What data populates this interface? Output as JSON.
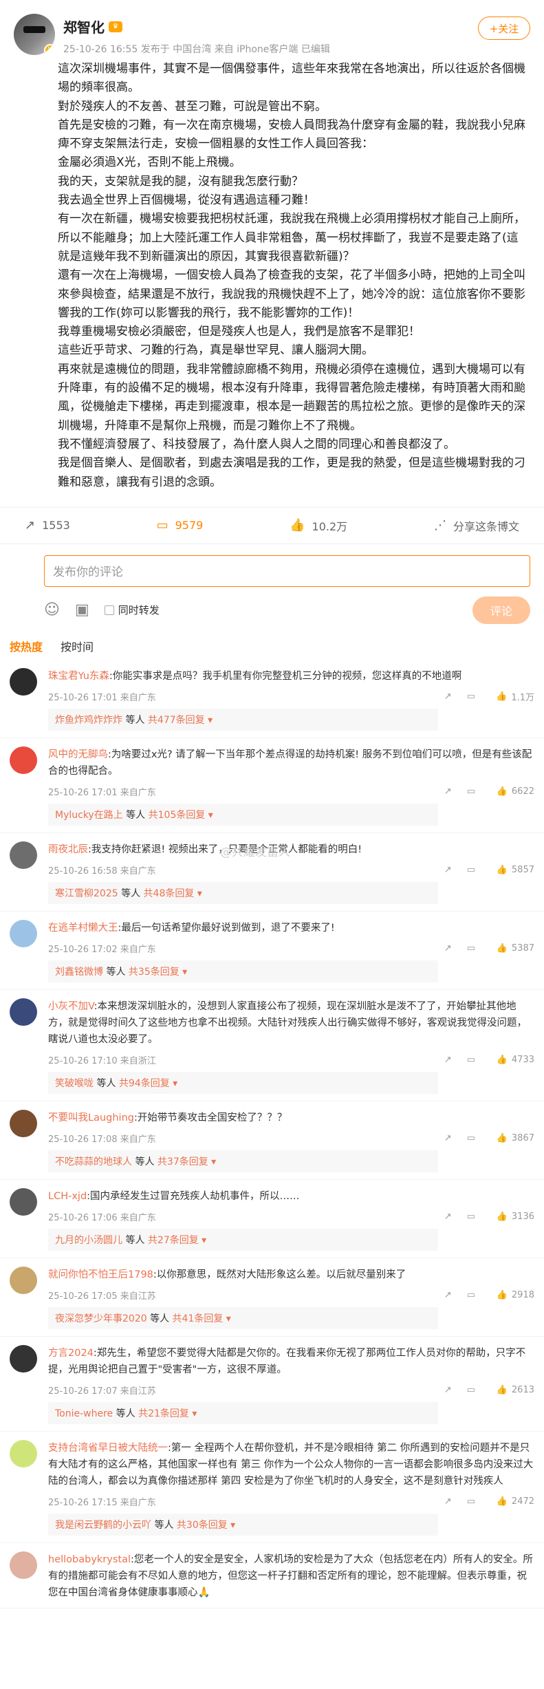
{
  "post": {
    "user_name": "郑智化",
    "meta": "25-10-26 16:55  发布于 中国台湾  来自 iPhone客户端  已编辑",
    "follow_label": "+关注",
    "paragraphs": [
      "這次深圳機場事件，其實不是一個偶發事件，這些年來我常在各地演出，所以往返於各個機場的頻率很高。",
      "對於殘疾人的不友善、甚至刁難，可說是管出不窮。",
      "首先是安檢的刁難，有一次在南京機場，安檢人員問我為什麼穿有金屬的鞋，我說我小兒麻痺不穿支架無法行走，安檢一個粗暴的女性工作人員回答我：",
      "金屬必須過X光，否則不能上飛機。",
      "我的天，支架就是我的腿，沒有腿我怎麼行動？",
      "我去過全世界上百個機場，從沒有遇過這種刁難！",
      "有一次在新疆，機場安檢要我把枴杖託運，我說我在飛機上必須用撐枴杖才能自己上廁所，所以不能離身；加上大陸託運工作人員非常粗魯，萬一枴杖摔斷了，我豈不是要走路了(這就是這幾年我不到新疆演出的原因，其實我很喜歡新疆)？",
      "還有一次在上海機場，一個安檢人員為了檢查我的支架，花了半個多小時，把她的上司全叫來參與檢查，結果還是不放行，我說我的飛機快趕不上了，她冷冷的說：這位旅客你不要影響我的工作(妳可以影響我的飛行，我不能影響妳的工作)！",
      "我尊重機場安檢必須嚴密，但是殘疾人也是人，我們是旅客不是罪犯！",
      "這些近乎苛求、刁難的行為，真是舉世罕見、讓人腦洞大開。",
      "再來就是遠機位的問題，我非常體諒廊橋不夠用，飛機必須停在遠機位，遇到大機場可以有升降車，有的設備不足的機場，根本沒有升降車，我得冒著危險走樓梯，有時頂著大雨和颱風，從機艙走下樓梯，再走到擺渡車，根本是一趟艱苦的馬拉松之旅。更慘的是像昨天的深圳機場，升降車不是幫你上飛機，而是刁難你上不了飛機。",
      "我不懂經濟發展了、科技發展了，為什麼人與人之間的同理心和善良都沒了。",
      "我是個音樂人、是個歌者，到處去演唱是我的工作，更是我的熱愛，但是這些機場對我的刁難和惡意，讓我有引退的念頭。"
    ],
    "actions": {
      "repost": "1553",
      "comments": "9579",
      "likes": "10.2万",
      "share": "分享这条博文"
    }
  },
  "composer": {
    "placeholder": "发布你的评论",
    "repost_label": "同时转发",
    "submit_label": "评论"
  },
  "sort_tabs": {
    "hot": "按热度",
    "time": "按时间"
  },
  "watermark": "@共耀发富人",
  "comments": [
    {
      "user": "珠宝君Yu东森",
      "text": ":你能实事求是点吗？我手机里有你完整登机三分钟的视频，您这样真的不地道啊",
      "meta": "25-10-26 17:01  来自广东",
      "likes": "1.1万",
      "reply_user": "炸鱼炸鸡炸炸炸",
      "reply_suffix": " 等人 ",
      "reply_count": "共477条回复 ▾"
    },
    {
      "user": "风中的无脚鸟",
      "text": ":为啥要过x光? 请了解一下当年那个差点得逞的劫持机案! 服务不到位咱们可以喷，但是有些该配合的也得配合。",
      "meta": "25-10-26 17:01  来自广东",
      "likes": "6622",
      "reply_user": "Mylucky在路上",
      "reply_suffix": " 等人 ",
      "reply_count": "共105条回复 ▾"
    },
    {
      "user": "雨夜北辰",
      "text": ":我支持你赶紧退! 视频出来了，只要是个正常人都能看的明白!",
      "meta": "25-10-26 16:58  来自广东",
      "likes": "5857",
      "reply_user": "寒江雪柳2025",
      "reply_suffix": " 等人 ",
      "reply_count": "共48条回复 ▾"
    },
    {
      "user": "在逃羊村懒大王",
      "text": ":最后一句话希望你最好说到做到，退了不要来了!",
      "meta": "25-10-26 17:02  来自广东",
      "likes": "5387",
      "reply_user": "刘鑫铭微博",
      "reply_suffix": " 等人 ",
      "reply_count": "共35条回复 ▾"
    },
    {
      "user": "小灰不加V",
      "text": ":本来想泼深圳脏水的，没想到人家直接公布了视频，现在深圳脏水是泼不了了，开始攀扯其他地方，就是觉得时间久了这些地方也拿不出视频。大陆针对残疾人出行确实做得不够好，客观说我觉得没问题，瞎说八道也太没必要了。",
      "meta": "25-10-26 17:10  来自浙江",
      "likes": "4733",
      "reply_user": "笑破喉咙",
      "reply_suffix": " 等人 ",
      "reply_count": "共94条回复 ▾"
    },
    {
      "user": "不要叫我Laughing",
      "text": ":开始带节奏攻击全国安检了？？？",
      "meta": "25-10-26 17:08  来自广东",
      "likes": "3867",
      "reply_user": "不吃蒜蒜的地球人",
      "reply_suffix": " 等人 ",
      "reply_count": "共37条回复 ▾"
    },
    {
      "user": "LCH-xjd",
      "text": ":国内承经发生过冒充残疾人劫机事件，所以……",
      "meta": "25-10-26 17:06  来自广东",
      "likes": "3136",
      "reply_user": "九月的小汤圆儿",
      "reply_suffix": " 等人 ",
      "reply_count": "共27条回复 ▾"
    },
    {
      "user": "就问你怕不怕王后1798",
      "text": ":以你那意思，既然对大陆形象这么差。以后就尽量别来了",
      "meta": "25-10-26 17:05  来自江苏",
      "likes": "2918",
      "reply_user": "夜深忽梦少年事2020",
      "reply_suffix": " 等人 ",
      "reply_count": "共41条回复 ▾"
    },
    {
      "user": "方言2024",
      "text": ":郑先生，希望您不要觉得大陆都是欠你的。在我看来你无视了那两位工作人员对你的帮助，只字不提，光用舆论把自己置于\"受害者\"一方，这很不厚道。",
      "meta": "25-10-26 17:07  来自江苏",
      "likes": "2613",
      "reply_user": "Tonie-where",
      "reply_suffix": " 等人 ",
      "reply_count": "共21条回复 ▾"
    },
    {
      "user": "支持台湾省早日被大陆统一",
      "text": ":第一 全程两个人在帮你登机，并不是冷眼相待 第二 你所遇到的安检问题并不是只有大陆才有的这么严格，其他国家一样也有 第三 你作为一个公众人物你的一言一语都会影响很多岛内没来过大陆的台湾人，都会以为真像你描述那样 第四 安检是为了你坐飞机时的人身安全，这不是刻意针对残疾人",
      "meta": "25-10-26 17:15  来自广东",
      "likes": "2472",
      "reply_user": "我是闲云野鹤的小云吖",
      "reply_suffix": " 等人 ",
      "reply_count": "共30条回复 ▾"
    },
    {
      "user": "hellobabykrystal",
      "text": ":您老一个人的安全是安全，人家机场的安检是为了大众（包括您老在内）所有人的安全。所有的措施都可能会有不尽如人意的地方，但您这一杆子打翻和否定所有的理论，恕不能理解。但表示尊重，祝您在中国台湾省身体健康事事顺心🙏",
      "meta": "",
      "likes": "",
      "reply_user": "",
      "reply_suffix": "",
      "reply_count": ""
    }
  ]
}
